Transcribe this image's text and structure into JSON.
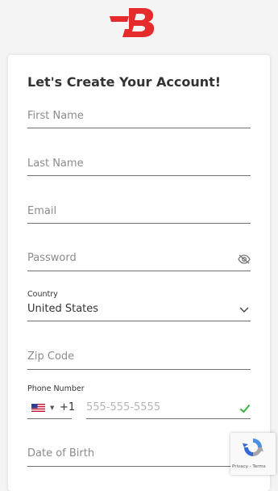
{
  "app": {
    "logo_letter": "B",
    "brand_color": "#e52b2b"
  },
  "form": {
    "heading": "Let's Create Your Account!",
    "first_name": {
      "placeholder": "First Name"
    },
    "last_name": {
      "placeholder": "Last Name"
    },
    "email": {
      "placeholder": "Email"
    },
    "password": {
      "placeholder": "Password",
      "visibility_icon": "eye-off-icon"
    },
    "country": {
      "label": "Country",
      "value": "United States",
      "icon": "chevron-down-icon"
    },
    "zip": {
      "placeholder": "Zip Code"
    },
    "phone": {
      "label": "Phone Number",
      "flag_icon": "us-flag-icon",
      "dial_code": "+1",
      "placeholder": "555-555-5555",
      "valid_icon": "check-icon",
      "valid_color": "#3cb043"
    },
    "dob": {
      "placeholder": "Date of Birth"
    }
  },
  "recaptcha": {
    "links": "Privacy - Terms"
  }
}
